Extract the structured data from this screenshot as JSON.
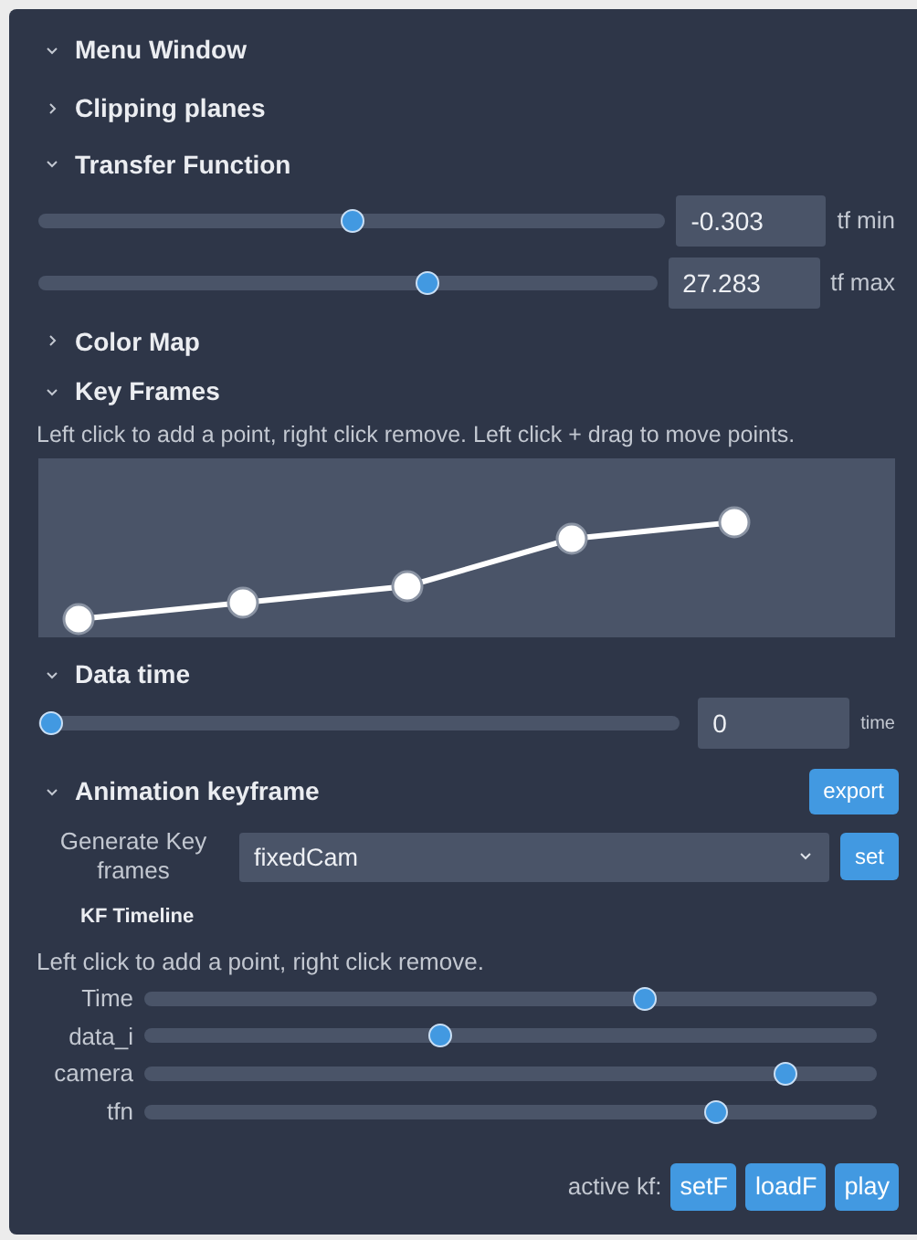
{
  "menu_window": {
    "title": "Menu Window",
    "expanded": true
  },
  "clipping_planes": {
    "title": "Clipping planes",
    "expanded": false
  },
  "transfer_function": {
    "title": "Transfer Function",
    "expanded": true,
    "sliders": [
      {
        "level": 0.5,
        "value": "-0.303",
        "label": "tf min"
      },
      {
        "level": 0.635,
        "value": "27.283",
        "label": "tf max"
      }
    ]
  },
  "color_map": {
    "title": "Color Map",
    "expanded": false
  },
  "key_frames": {
    "title": "Key Frames",
    "expanded": true,
    "hint": "Left click to add a point, right click remove. Left click + drag to move points."
  },
  "data_time": {
    "title": "Data time",
    "expanded": true,
    "slider": {
      "level": 0,
      "value": "0",
      "label": "time"
    }
  },
  "animation_keyframe": {
    "title": "Animation keyframe",
    "expanded": true,
    "export_button": "export",
    "generate_label": "Generate Key frames",
    "select_value": "fixedCam",
    "set_button": "set",
    "timeline": {
      "title": "KF Timeline",
      "hint": "Left click to add a point, right click remove.",
      "tracks": [
        {
          "label": "Time",
          "level": 0.69
        },
        {
          "label": "data_i",
          "level": 0.4
        },
        {
          "label": "camera",
          "level": 0.89
        },
        {
          "label": "tfn",
          "level": 0.79
        }
      ]
    },
    "active_label": "active kf:",
    "buttons": [
      "setF",
      "loadF",
      "play"
    ]
  }
}
